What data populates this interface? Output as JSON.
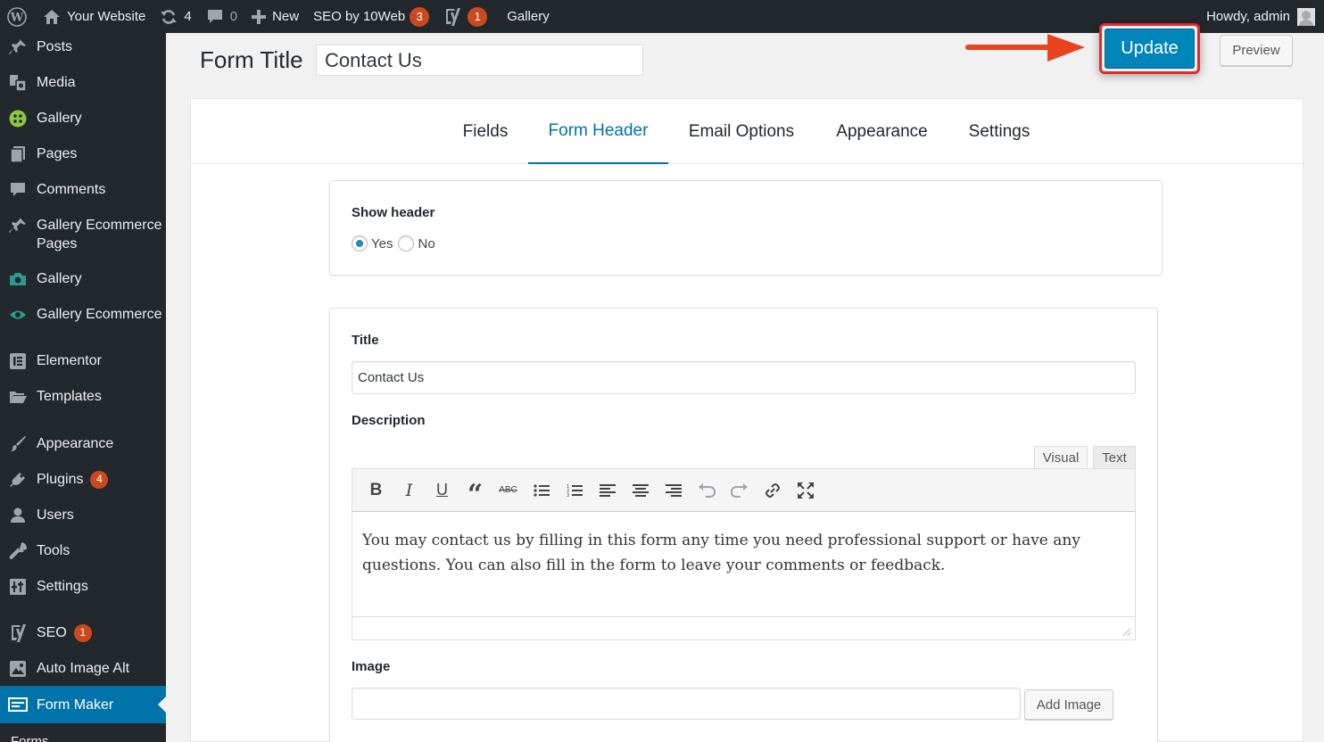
{
  "admin_bar": {
    "site_name": "Your Website",
    "updates_count": "4",
    "comments_count": "0",
    "new_label": "New",
    "seo_plugin_label": "SEO by 10Web",
    "seo_plugin_badge": "3",
    "yoast_badge": "1",
    "gallery_label": "Gallery",
    "howdy": "Howdy, admin"
  },
  "sidebar": {
    "items": [
      {
        "label": "Posts",
        "icon": "pushpin-icon"
      },
      {
        "label": "Media",
        "icon": "media-icon"
      },
      {
        "label": "Gallery",
        "icon": "gallery-icon"
      },
      {
        "label": "Pages",
        "icon": "pages-icon"
      },
      {
        "label": "Comments",
        "icon": "comments-icon"
      },
      {
        "label": "Gallery Ecommerce Pages",
        "icon": "pushpin-icon"
      },
      {
        "label": "Gallery",
        "icon": "camera-icon"
      },
      {
        "label": "Gallery Ecommerce",
        "icon": "eye-icon"
      },
      {
        "label": "Elementor",
        "icon": "elementor-icon"
      },
      {
        "label": "Templates",
        "icon": "folder-icon"
      },
      {
        "label": "Appearance",
        "icon": "brush-icon"
      },
      {
        "label": "Plugins",
        "icon": "plugin-icon",
        "badge": "4"
      },
      {
        "label": "Users",
        "icon": "users-icon"
      },
      {
        "label": "Tools",
        "icon": "wrench-icon"
      },
      {
        "label": "Settings",
        "icon": "settings-icon"
      },
      {
        "label": "SEO",
        "icon": "yoast-icon",
        "badge": "1"
      },
      {
        "label": "Auto Image Alt",
        "icon": "image-icon"
      },
      {
        "label": "Form Maker",
        "icon": "form-icon"
      }
    ],
    "submenu_first": "Forms"
  },
  "header": {
    "form_title_label": "Form Title",
    "form_title_value": "Contact Us",
    "update_label": "Update",
    "preview_label": "Preview"
  },
  "tabs": [
    "Fields",
    "Form Header",
    "Email Options",
    "Appearance",
    "Settings"
  ],
  "active_tab": "Form Header",
  "show_header": {
    "label": "Show header",
    "options": [
      "Yes",
      "No"
    ],
    "selected": "Yes"
  },
  "title_field": {
    "label": "Title",
    "value": "Contact Us"
  },
  "description": {
    "label": "Description",
    "editor_tabs": [
      "Visual",
      "Text"
    ],
    "content": "You may contact us by filling in this form any time you need professional support or have any questions. You can also fill in the form to leave your comments or feedback."
  },
  "image_field": {
    "label": "Image",
    "value": "",
    "button_label": "Add Image"
  },
  "colors": {
    "admin_bar": "#23282d",
    "accent": "#0073aa",
    "update_button": "#0085ba",
    "badge": "#ca4a1f",
    "highlight_outline": "#e02c2c",
    "arrow": "#e8431d"
  }
}
